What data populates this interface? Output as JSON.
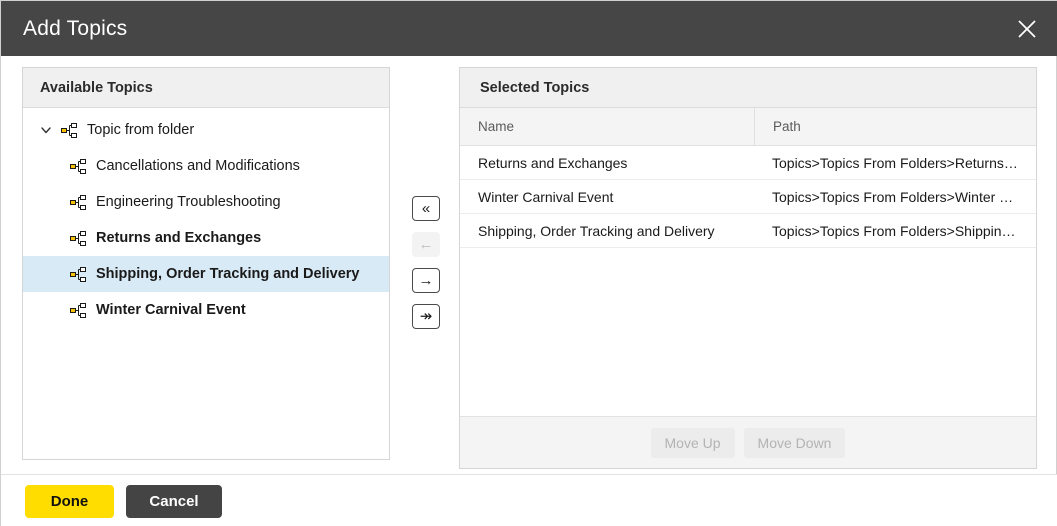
{
  "dialog": {
    "title": "Add Topics",
    "close_icon": "close-icon"
  },
  "left_panel": {
    "header": "Available Topics",
    "tree": [
      {
        "label": "Topic from folder",
        "level": 0,
        "expanded": true,
        "bold": false,
        "selected": false,
        "icon": "topic-icon"
      },
      {
        "label": "Cancellations and Modifications",
        "level": 1,
        "expanded": false,
        "bold": false,
        "selected": false,
        "icon": "topic-icon"
      },
      {
        "label": "Engineering Troubleshooting",
        "level": 1,
        "expanded": false,
        "bold": false,
        "selected": false,
        "icon": "topic-icon"
      },
      {
        "label": "Returns and Exchanges",
        "level": 1,
        "expanded": false,
        "bold": true,
        "selected": false,
        "icon": "topic-icon"
      },
      {
        "label": "Shipping, Order Tracking and Delivery",
        "level": 1,
        "expanded": false,
        "bold": true,
        "selected": true,
        "icon": "topic-icon"
      },
      {
        "label": "Winter Carnival Event",
        "level": 1,
        "expanded": false,
        "bold": true,
        "selected": false,
        "icon": "topic-icon"
      }
    ]
  },
  "transfer": {
    "buttons": [
      {
        "name": "remove-all-button",
        "icon": "double-chevron-left-icon",
        "glyph": "«",
        "enabled": true
      },
      {
        "name": "remove-selected-button",
        "icon": "arrow-left-icon",
        "glyph": "←",
        "enabled": false
      },
      {
        "name": "add-selected-button",
        "icon": "arrow-right-icon",
        "glyph": "→",
        "enabled": true
      },
      {
        "name": "add-all-button",
        "icon": "double-arrow-right-icon",
        "glyph": "↠",
        "enabled": true
      }
    ]
  },
  "right_panel": {
    "header": "Selected Topics",
    "columns": [
      "Name",
      "Path"
    ],
    "rows": [
      {
        "name": "Returns and Exchanges",
        "path": "Topics>Topics From Folders>Returns…"
      },
      {
        "name": "Winter Carnival Event",
        "path": "Topics>Topics From Folders>Winter …"
      },
      {
        "name": "Shipping, Order Tracking and Delivery",
        "path": "Topics>Topics From Folders>Shippin…"
      }
    ],
    "move_up_label": "Move Up",
    "move_down_label": "Move Down",
    "move_up_enabled": false,
    "move_down_enabled": false
  },
  "footer": {
    "done_label": "Done",
    "cancel_label": "Cancel"
  },
  "colors": {
    "titlebar": "#464646",
    "accent_yellow": "#ffdd00",
    "cancel_dark": "#444444",
    "selection": "#d9eaf7",
    "icon_yellow": "#f7c200"
  }
}
